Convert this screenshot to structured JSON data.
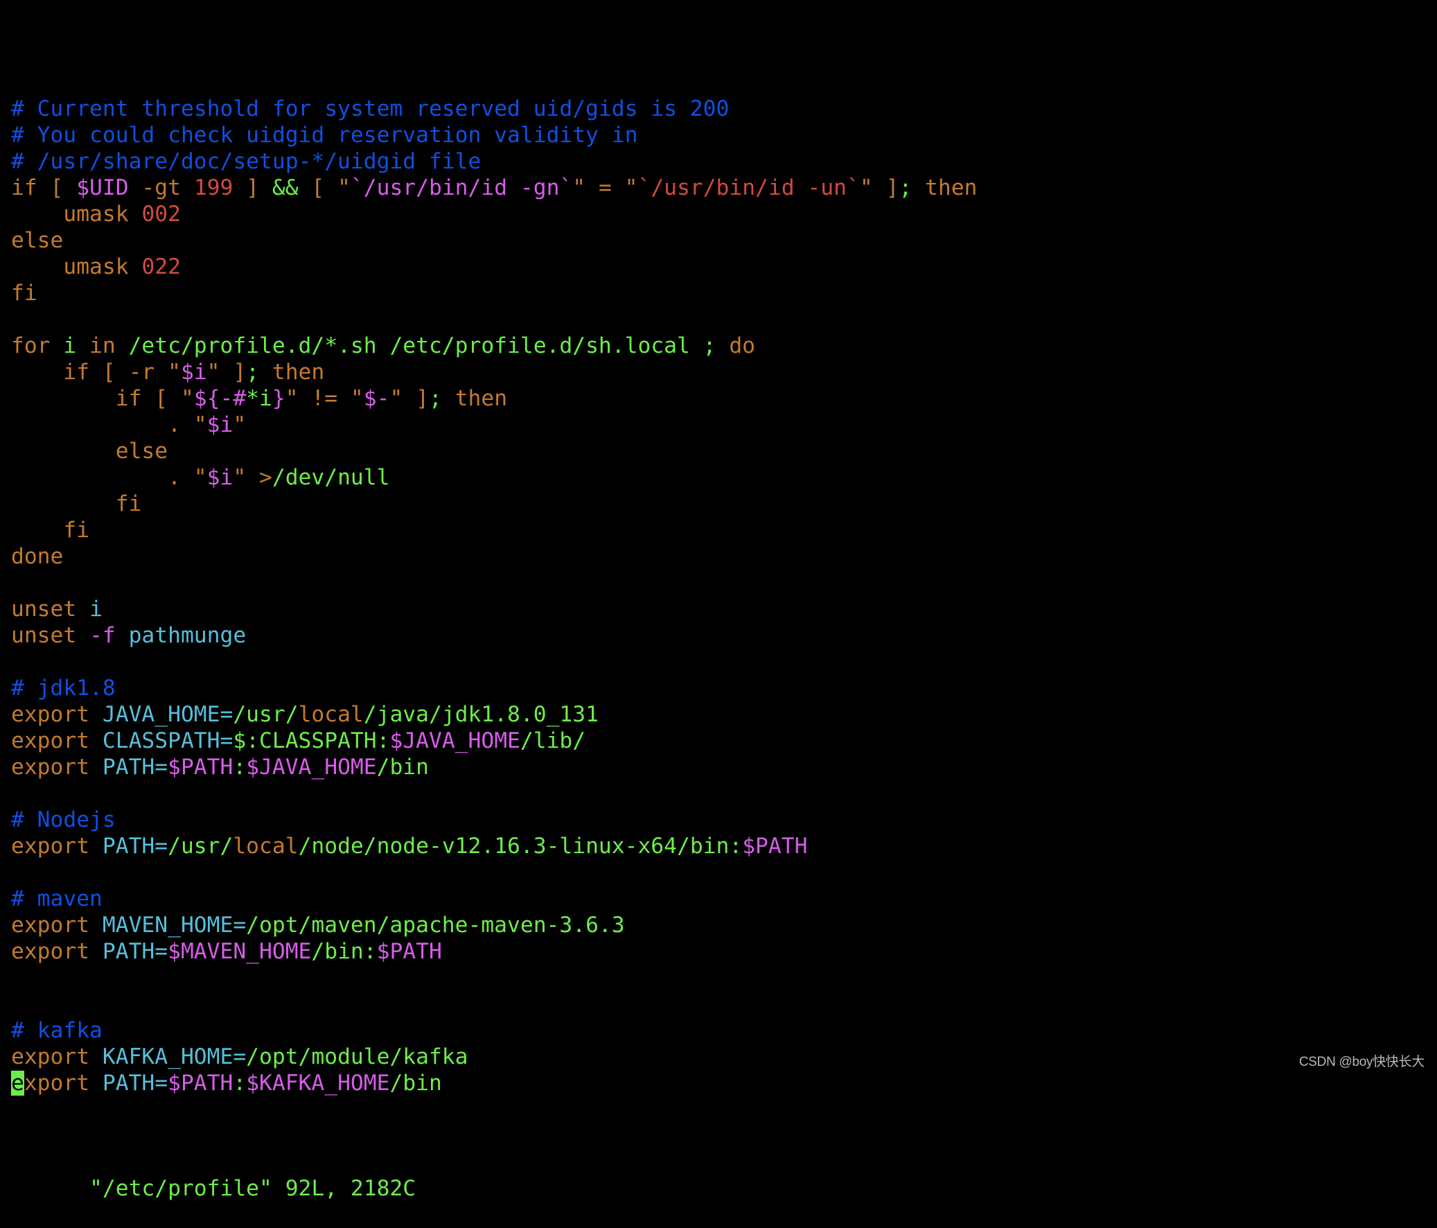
{
  "editor": {
    "app": "vim",
    "file_name": "/etc/profile",
    "colors": {
      "comment": "#0f4fe2",
      "keyword": "#c47a2e",
      "number": "#d24a3e",
      "variable": "#d75ce9",
      "string": "#6cee4a",
      "identifier": "#55bfdb",
      "background": "#000000",
      "cursor": "#6cee4a"
    },
    "cursor": {
      "line": 38,
      "column": 1,
      "char": "e"
    },
    "lines": [
      [
        [
          "# Current threshold for system reserved uid/gids is 200",
          "comment"
        ]
      ],
      [
        [
          "# You could check uidgid reservation validity in",
          "comment"
        ]
      ],
      [
        [
          "# /usr/share/doc/setup-*/uidgid file",
          "comment"
        ]
      ],
      [
        [
          "if [ ",
          "keyword"
        ],
        [
          "$UID",
          "variable"
        ],
        [
          " -gt ",
          "keyword"
        ],
        [
          "199",
          "number"
        ],
        [
          " ] ",
          "keyword"
        ],
        [
          "&&",
          "string"
        ],
        [
          " [ \"",
          "keyword"
        ],
        [
          "`/usr/bin/id -gn`",
          "variable"
        ],
        [
          "\" = \"",
          "keyword"
        ],
        [
          "`/usr/bin/id -un`",
          "number"
        ],
        [
          "\" ]",
          "keyword"
        ],
        [
          ";",
          "string"
        ],
        [
          " then",
          "keyword"
        ]
      ],
      [
        [
          "    umask ",
          "keyword"
        ],
        [
          "002",
          "number"
        ]
      ],
      [
        [
          "else",
          "keyword"
        ]
      ],
      [
        [
          "    umask ",
          "keyword"
        ],
        [
          "022",
          "number"
        ]
      ],
      [
        [
          "fi",
          "keyword"
        ]
      ],
      [],
      [
        [
          "for ",
          "keyword"
        ],
        [
          "i",
          "string"
        ],
        [
          " in ",
          "keyword"
        ],
        [
          "/etc/profile.d/*.sh /etc/profile.d/sh.local ",
          "string"
        ],
        [
          ";",
          "string"
        ],
        [
          " do",
          "keyword"
        ]
      ],
      [
        [
          "    if [ -r \"",
          "keyword"
        ],
        [
          "$i",
          "variable"
        ],
        [
          "\" ]",
          "keyword"
        ],
        [
          ";",
          "string"
        ],
        [
          " then",
          "keyword"
        ]
      ],
      [
        [
          "        if [ \"",
          "keyword"
        ],
        [
          "${-#",
          "variable"
        ],
        [
          "*i",
          "string"
        ],
        [
          "}",
          "variable"
        ],
        [
          "\" != \"",
          "keyword"
        ],
        [
          "$-",
          "variable"
        ],
        [
          "\" ]",
          "keyword"
        ],
        [
          ";",
          "string"
        ],
        [
          " then",
          "keyword"
        ]
      ],
      [
        [
          "            . \"",
          "keyword"
        ],
        [
          "$i",
          "variable"
        ],
        [
          "\"",
          "keyword"
        ]
      ],
      [
        [
          "        else",
          "keyword"
        ]
      ],
      [
        [
          "            . \"",
          "keyword"
        ],
        [
          "$i",
          "variable"
        ],
        [
          "\" >",
          "keyword"
        ],
        [
          "/dev/null",
          "string"
        ]
      ],
      [
        [
          "        fi",
          "keyword"
        ]
      ],
      [
        [
          "    fi",
          "keyword"
        ]
      ],
      [
        [
          "done",
          "keyword"
        ]
      ],
      [],
      [
        [
          "unset ",
          "keyword"
        ],
        [
          "i",
          "identifier"
        ]
      ],
      [
        [
          "unset ",
          "keyword"
        ],
        [
          "-f",
          "variable"
        ],
        [
          " ",
          "keyword"
        ],
        [
          "pathmunge",
          "identifier"
        ]
      ],
      [],
      [
        [
          "# jdk1.8",
          "comment"
        ]
      ],
      [
        [
          "export ",
          "keyword"
        ],
        [
          "JAVA_HOME=",
          "identifier"
        ],
        [
          "/usr/",
          "string"
        ],
        [
          "local",
          "keyword"
        ],
        [
          "/java/jdk1.8.0_131",
          "string"
        ]
      ],
      [
        [
          "export ",
          "keyword"
        ],
        [
          "CLASSPATH=",
          "identifier"
        ],
        [
          "$:CLASSPATH:",
          "string"
        ],
        [
          "$JAVA_HOME",
          "variable"
        ],
        [
          "/lib/",
          "string"
        ]
      ],
      [
        [
          "export ",
          "keyword"
        ],
        [
          "PATH=",
          "identifier"
        ],
        [
          "$PATH",
          "variable"
        ],
        [
          ":",
          "string"
        ],
        [
          "$JAVA_HOME",
          "variable"
        ],
        [
          "/bin",
          "string"
        ]
      ],
      [],
      [
        [
          "# Nodejs",
          "comment"
        ]
      ],
      [
        [
          "export ",
          "keyword"
        ],
        [
          "PATH=",
          "identifier"
        ],
        [
          "/usr/",
          "string"
        ],
        [
          "local",
          "keyword"
        ],
        [
          "/node/node-v12.16.3-linux-x64/bin:",
          "string"
        ],
        [
          "$PATH",
          "variable"
        ]
      ],
      [],
      [
        [
          "# maven",
          "comment"
        ]
      ],
      [
        [
          "export ",
          "keyword"
        ],
        [
          "MAVEN_HOME=",
          "identifier"
        ],
        [
          "/opt/maven/apache-maven-3.6.3",
          "string"
        ]
      ],
      [
        [
          "export ",
          "keyword"
        ],
        [
          "PATH=",
          "identifier"
        ],
        [
          "$MAVEN_HOME",
          "variable"
        ],
        [
          "/bin:",
          "string"
        ],
        [
          "$PATH",
          "variable"
        ]
      ],
      [],
      [],
      [
        [
          "# kafka",
          "comment"
        ]
      ],
      [
        [
          "export ",
          "keyword"
        ],
        [
          "KAFKA_HOME=",
          "identifier"
        ],
        [
          "/opt/module/kafka",
          "string"
        ]
      ],
      [
        [
          "e",
          "cursor"
        ],
        [
          "xport ",
          "keyword"
        ],
        [
          "PATH=",
          "identifier"
        ],
        [
          "$PATH",
          "variable"
        ],
        [
          ":",
          "string"
        ],
        [
          "$KAFKA_HOME",
          "variable"
        ],
        [
          "/bin",
          "string"
        ]
      ]
    ],
    "status_line": {
      "file": "\"/etc/profile\"",
      "line_count": "92L",
      "char_count": "2182C",
      "text": "\"/etc/profile\" 92L, 2182C"
    }
  },
  "watermark": "CSDN @boy快快长大"
}
